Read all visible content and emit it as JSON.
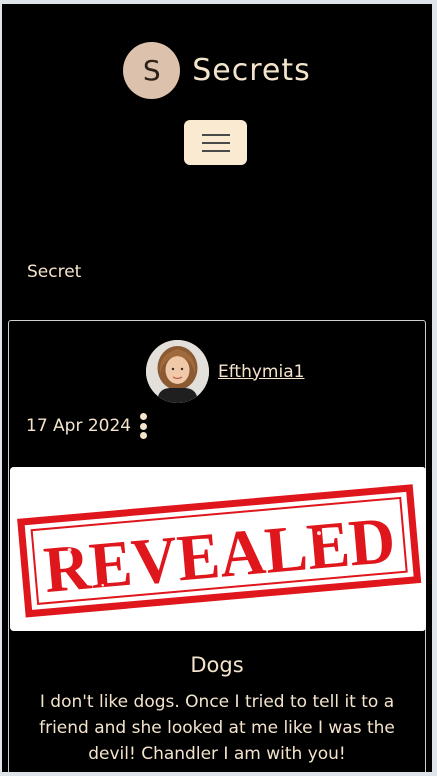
{
  "brand": {
    "logo_letter": "S",
    "name": "Secrets"
  },
  "page": {
    "section_title": "Secret"
  },
  "post": {
    "author": "Efthymia1",
    "date": "17 Apr 2024",
    "image_text": "REVEALED",
    "title": "Dogs",
    "body": "I don't like dogs. Once I tried to tell it to a friend and she looked at me like I was the devil! Chandler I am with you!"
  },
  "colors": {
    "background": "#000000",
    "accent_cream": "#f4e4cc",
    "logo_circle": "#dcc2ad",
    "toggle_bg": "#fbead2",
    "stamp_red": "#e0161d"
  },
  "icons": {
    "menu": "hamburger-icon",
    "options": "kebab-vertical-icon"
  }
}
